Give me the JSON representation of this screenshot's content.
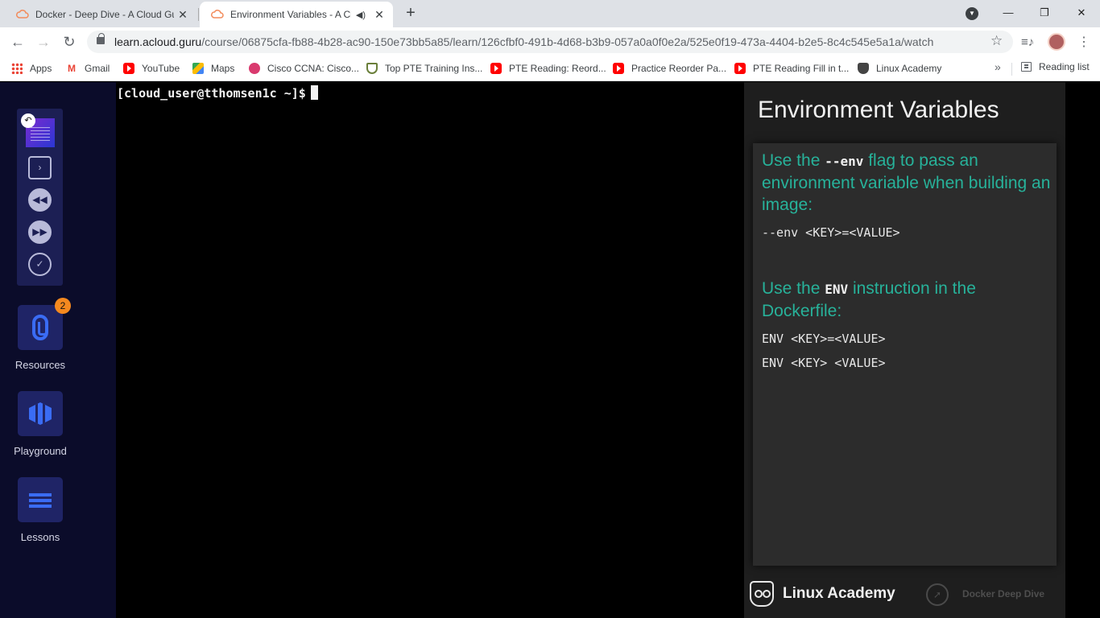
{
  "browser": {
    "tabs": [
      {
        "title": "Docker - Deep Dive - A Cloud Guru",
        "active": false
      },
      {
        "title": "Environment Variables - A Cloud Guru",
        "active": true
      }
    ],
    "new_tab": "+",
    "window_controls": {
      "minimize": "—",
      "restore": "❐",
      "close": "✕"
    },
    "url_host": "learn.acloud.guru",
    "url_path": "/course/06875cfa-fb88-4b28-ac90-150e73bb5a85/learn/126cfbf0-491b-4d68-b3b9-057a0a0f0e2a/525e0f19-473a-4404-b2e5-8c4c545e5a1a/watch",
    "bookmarks": [
      {
        "label": "Apps",
        "icon": "apps-grid-icon"
      },
      {
        "label": "Gmail",
        "icon": "gmail-icon"
      },
      {
        "label": "YouTube",
        "icon": "youtube-icon"
      },
      {
        "label": "Maps",
        "icon": "maps-icon"
      },
      {
        "label": "Cisco CCNA: Cisco...",
        "icon": "cisco-icon"
      },
      {
        "label": "Top PTE Training Ins...",
        "icon": "pte-shield-icon"
      },
      {
        "label": "PTE Reading: Reord...",
        "icon": "youtube-icon"
      },
      {
        "label": "Practice Reorder Pa...",
        "icon": "youtube-icon"
      },
      {
        "label": "PTE Reading Fill in t...",
        "icon": "youtube-icon"
      },
      {
        "label": "Linux Academy",
        "icon": "linux-academy-icon"
      }
    ],
    "bookmarks_more": "»",
    "reading_list": "Reading list"
  },
  "sidebar": {
    "resources": {
      "label": "Resources",
      "badge": "2"
    },
    "playground": {
      "label": "Playground"
    },
    "lessons": {
      "label": "Lessons"
    }
  },
  "terminal": {
    "prompt": "[cloud_user@tthomsen1c ~]$"
  },
  "slide": {
    "title": "Environment Variables",
    "section1": {
      "pre": "Use the ",
      "keyword": "--env",
      "post": "  flag to pass an environment variable when building an image:"
    },
    "code1": "--env <KEY>=<VALUE>",
    "section2": {
      "pre": "Use the ",
      "keyword": "ENV",
      "post": " instruction in the Dockerfile:"
    },
    "code2": "ENV <KEY>=<VALUE>",
    "code3": "ENV <KEY> <VALUE>",
    "brand": "Linux Academy",
    "course_brand": "Docker Deep Dive"
  },
  "colors": {
    "sidebar_bg": "#0b0c2a",
    "tile_bg": "#1f2466",
    "accent_blue": "#3a6cf4",
    "badge_orange": "#f5891f",
    "slide_teal": "#27b29a"
  }
}
